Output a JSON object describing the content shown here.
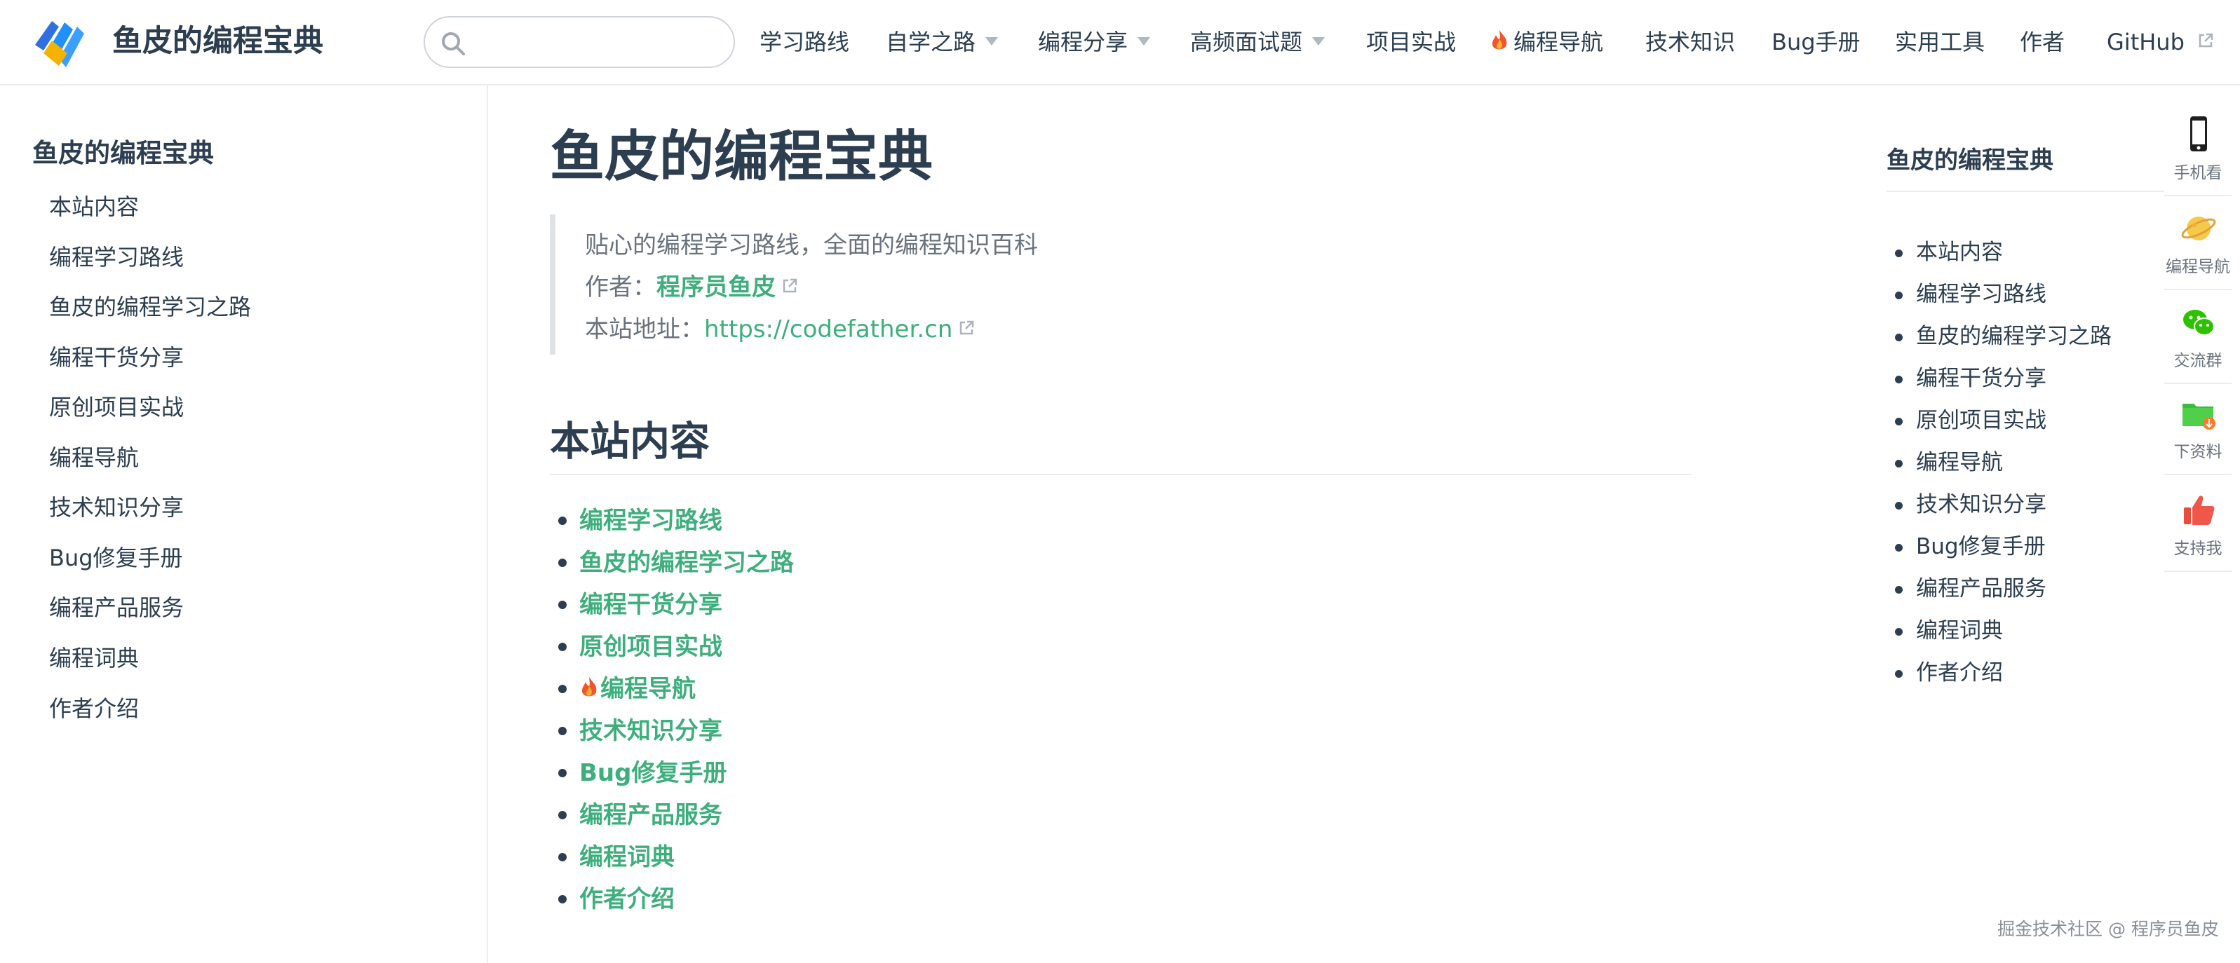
{
  "header": {
    "site_name": "鱼皮的编程宝典",
    "search_value": "",
    "nav": [
      {
        "label": "学习路线",
        "dropdown": false
      },
      {
        "label": "自学之路",
        "dropdown": true
      },
      {
        "label": "编程分享",
        "dropdown": true
      },
      {
        "label": "高频面试题",
        "dropdown": true
      },
      {
        "label": "项目实战",
        "dropdown": false
      },
      {
        "label": "编程导航",
        "dropdown": false,
        "icon": "fire-icon"
      },
      {
        "label": "技术知识",
        "dropdown": false
      },
      {
        "label": "Bug手册",
        "dropdown": false
      },
      {
        "label": "实用工具",
        "dropdown": false
      },
      {
        "label": "作者",
        "dropdown": false
      },
      {
        "label": "GitHub",
        "dropdown": false,
        "icon": "external-link-icon"
      }
    ]
  },
  "sidebar": {
    "heading": "鱼皮的编程宝典",
    "items": [
      "本站内容",
      "编程学习路线",
      "鱼皮的编程学习之路",
      "编程干货分享",
      "原创项目实战",
      "编程导航",
      "技术知识分享",
      "Bug修复手册",
      "编程产品服务",
      "编程词典",
      "作者介绍"
    ]
  },
  "main": {
    "title": "鱼皮的编程宝典",
    "quote": {
      "tagline": "贴心的编程学习路线，全面的编程知识百科",
      "author_label": "作者：",
      "author_name": "程序员鱼皮",
      "site_label": "本站地址：",
      "site_url": "https://codefather.cn"
    },
    "section_title": "本站内容",
    "items": [
      "编程学习路线",
      "鱼皮的编程学习之路",
      "编程干货分享",
      "原创项目实战",
      "编程导航",
      "技术知识分享",
      "Bug修复手册",
      "编程产品服务",
      "编程词典",
      "作者介绍"
    ]
  },
  "toc": {
    "heading": "鱼皮的编程宝典",
    "items": [
      "本站内容",
      "编程学习路线",
      "鱼皮的编程学习之路",
      "编程干货分享",
      "原创项目实战",
      "编程导航",
      "技术知识分享",
      "Bug修复手册",
      "编程产品服务",
      "编程词典",
      "作者介绍"
    ]
  },
  "float_tools": [
    {
      "label": "手机看",
      "icon": "phone-icon"
    },
    {
      "label": "编程导航",
      "icon": "planet-icon"
    },
    {
      "label": "交流群",
      "icon": "wechat-icon"
    },
    {
      "label": "下资料",
      "icon": "folder-download-icon"
    },
    {
      "label": "支持我",
      "icon": "thumbs-up-icon"
    }
  ],
  "watermark": "掘金技术社区 @ 程序员鱼皮",
  "colors": {
    "accent": "#3eaf7c",
    "text": "#2c3e50",
    "muted": "#6a737d",
    "border": "#eaecef"
  }
}
